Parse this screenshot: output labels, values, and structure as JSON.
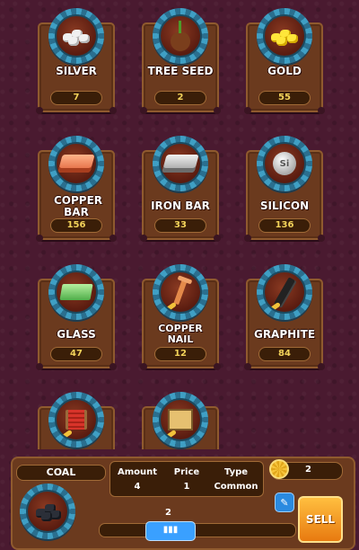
{
  "items": [
    {
      "name": "SILVER",
      "count": "7",
      "icon": "silver-nuggets-icon"
    },
    {
      "name": "TREE SEED",
      "count": "2",
      "icon": "tree-seed-icon"
    },
    {
      "name": "GOLD",
      "count": "55",
      "icon": "gold-nuggets-icon"
    },
    {
      "name": "COPPER BAR",
      "count": "156",
      "icon": "copper-bar-icon"
    },
    {
      "name": "IRON BAR",
      "count": "33",
      "icon": "iron-bar-icon"
    },
    {
      "name": "SILICON",
      "count": "136",
      "icon": "silicon-icon"
    },
    {
      "name": "GLASS",
      "count": "47",
      "icon": "glass-icon"
    },
    {
      "name": "COPPER NAIL",
      "count": "12",
      "icon": "copper-nail-icon"
    },
    {
      "name": "GRAPHITE",
      "count": "84",
      "icon": "graphite-icon"
    },
    {
      "icon": "wire-spool-icon"
    },
    {
      "icon": "circuit-box-icon"
    }
  ],
  "panel": {
    "selected_name": "COAL",
    "selected_icon": "coal-icon",
    "stats": [
      {
        "label": "Amount",
        "value": "4"
      },
      {
        "label": "Price",
        "value": "1"
      },
      {
        "label": "Type",
        "value": "Common"
      }
    ],
    "coins": "2",
    "sell_label": "SELL",
    "slider_value": "2",
    "slider_fraction": 0.5
  }
}
